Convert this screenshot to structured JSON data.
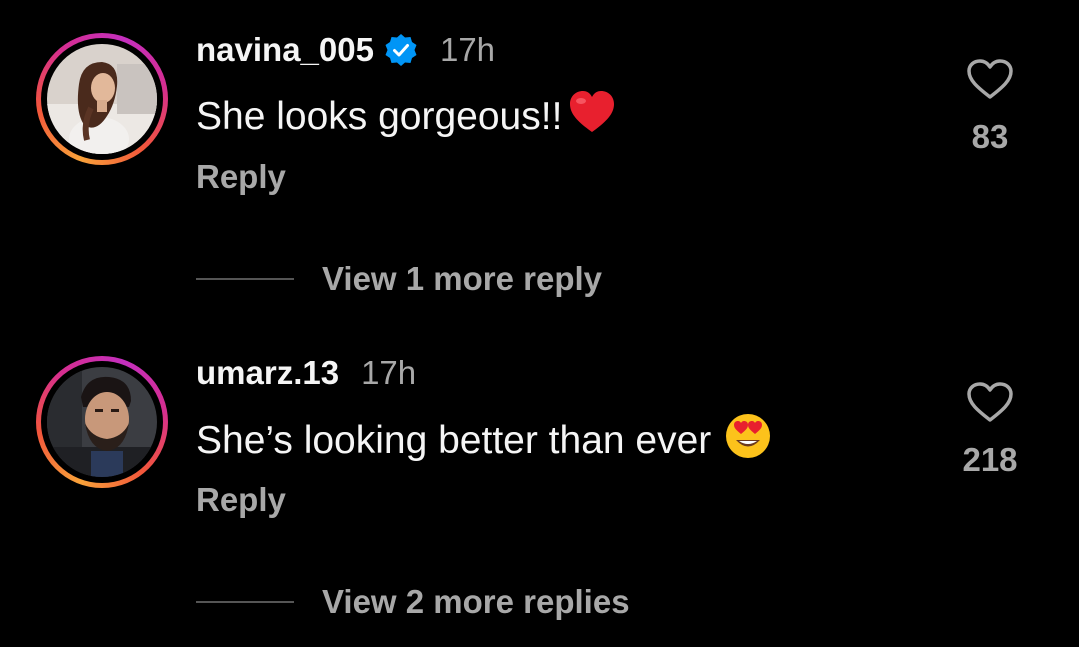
{
  "comments": [
    {
      "username": "navina_005",
      "verified": true,
      "time": "17h",
      "text": "She looks gorgeous!!",
      "emoji": "red-heart",
      "reply_label": "Reply",
      "likes": "83",
      "view_more": "View 1 more reply"
    },
    {
      "username": "umarz.13",
      "verified": false,
      "time": "17h",
      "text": "She’s looking better than ever",
      "emoji": "heart-eyes",
      "reply_label": "Reply",
      "likes": "218",
      "view_more": "View 2 more replies"
    }
  ],
  "colors": {
    "background": "#000000",
    "primary_text": "#f5f5f5",
    "secondary_text": "#a8a8a8",
    "verified_badge": "#0095f6",
    "story_ring": [
      "#f9a23a",
      "#f2563b",
      "#d62e8f",
      "#c42fbe"
    ]
  }
}
